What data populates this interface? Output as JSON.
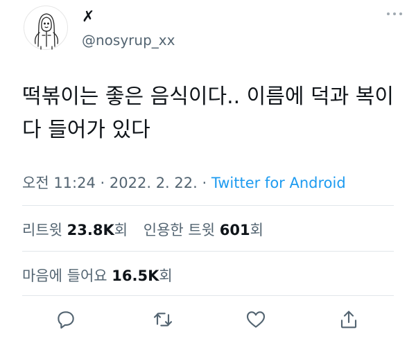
{
  "author": {
    "display_name": "✗",
    "handle": "@nosyrup_xx"
  },
  "tweet": {
    "text": "떡볶이는 좋은 음식이다.. 이름에 덕과 복이 다 들어가 있다",
    "time": "오전 11:24",
    "separator": "·",
    "date": "2022. 2. 22.",
    "source": "Twitter for Android"
  },
  "stats": {
    "retweets_label": "리트윗",
    "retweets_value": "23.8K",
    "retweets_unit": "회",
    "quotes_label": "인용한 트윗",
    "quotes_value": "601",
    "quotes_unit": "회",
    "likes_label": "마음에 들어요",
    "likes_value": "16.5K",
    "likes_unit": "회"
  },
  "actions": {
    "reply": "reply-icon",
    "retweet": "retweet-icon",
    "like": "heart-icon",
    "share": "share-icon"
  },
  "colors": {
    "link": "#1d9bf0",
    "secondary_text": "#536471",
    "primary_text": "#0f1419",
    "divider": "#e1e6ea"
  }
}
